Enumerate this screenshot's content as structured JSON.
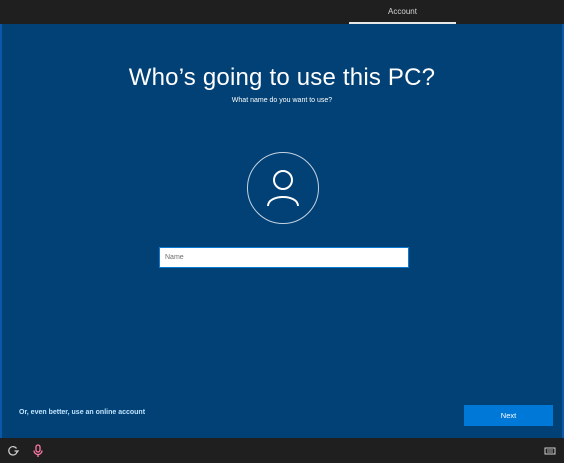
{
  "header": {
    "tab_label": "Account"
  },
  "main": {
    "title": "Who’s going to use this PC?",
    "subtitle": "What name do you want to use?",
    "name_input": {
      "placeholder": "Name",
      "value": ""
    },
    "online_account_link": "Or, even better, use an online account",
    "next_label": "Next"
  },
  "icons": {
    "avatar": "user-avatar-icon",
    "ease_of_access": "ease-of-access-icon",
    "microphone": "microphone-icon",
    "keyboard": "keyboard-icon"
  },
  "colors": {
    "background": "#024175",
    "accent": "#0078d7",
    "link": "#bfe4ff"
  }
}
